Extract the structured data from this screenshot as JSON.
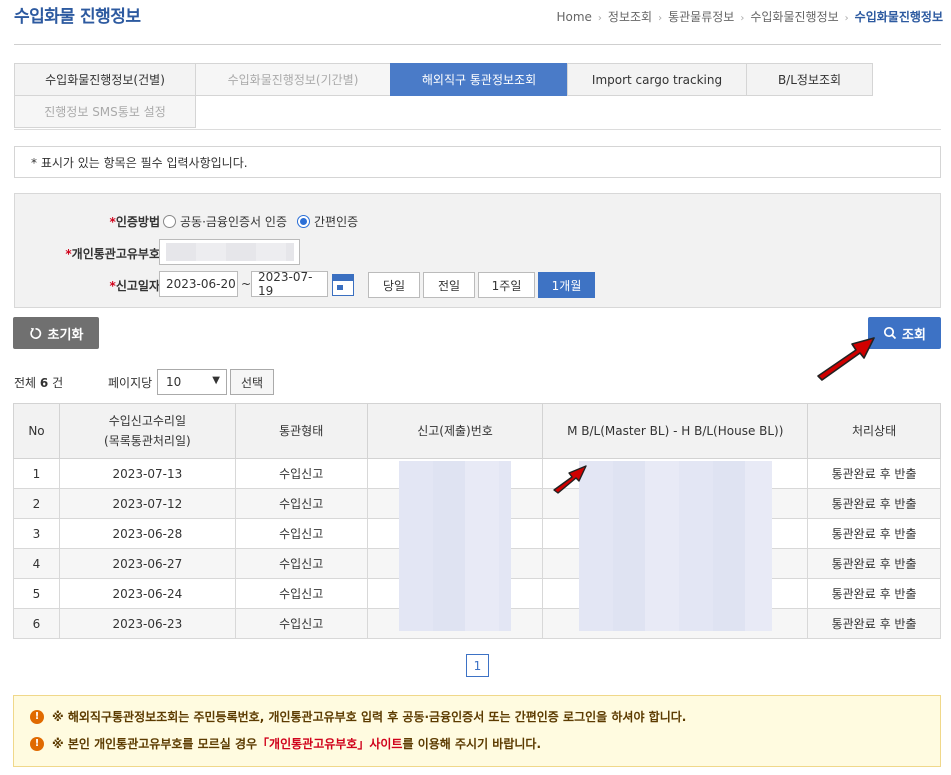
{
  "header": {
    "title": "수입화물 진행정보",
    "breadcrumb": [
      "Home",
      "정보조회",
      "통관물류정보",
      "수입화물진행정보",
      "수입화물진행정보"
    ]
  },
  "tabs": [
    [
      {
        "label": "수입화물진행정보(건별)",
        "state": "normal"
      },
      {
        "label": "수입화물진행정보(기간별)",
        "state": "disabled"
      },
      {
        "label": "해외직구 통관정보조회",
        "state": "active"
      },
      {
        "label": "Import cargo tracking",
        "state": "normal"
      },
      {
        "label": "B/L정보조회",
        "state": "normal"
      }
    ],
    [
      {
        "label": "진행정보 SMS통보 설정",
        "state": "disabled"
      }
    ]
  ],
  "notice": "* 표시가 있는 항목은 필수 입력사항입니다.",
  "form": {
    "auth_label": "인증방법",
    "auth_options": [
      {
        "label": "공동·금융인증서 인증",
        "checked": false
      },
      {
        "label": "간편인증",
        "checked": true
      }
    ],
    "pccc_label": "개인통관고유부호",
    "date_label": "신고일자",
    "date_from": "2023-06-20",
    "tilde": "~",
    "date_to": "2023-07-19",
    "period_buttons": [
      {
        "label": "당일",
        "active": false
      },
      {
        "label": "전일",
        "active": false
      },
      {
        "label": "1주일",
        "active": false
      },
      {
        "label": "1개월",
        "active": true
      }
    ]
  },
  "actions": {
    "reset": "초기화",
    "search": "조회"
  },
  "list": {
    "total_prefix": "전체",
    "total_count": "6",
    "total_suffix": "건",
    "per_page_label": "페이지당",
    "per_page_value": "10",
    "select_button": "선택"
  },
  "table": {
    "headers": [
      "No",
      "수입신고수리일",
      "(목록통관처리일)",
      "통관형태",
      "신고(제출)번호",
      "M B/L(Master BL) - H B/L(House BL))",
      "처리상태"
    ],
    "rows": [
      {
        "no": "1",
        "date": "2023-07-13",
        "type": "수입신고",
        "status": "통관완료 후 반출"
      },
      {
        "no": "2",
        "date": "2023-07-12",
        "type": "수입신고",
        "status": "통관완료 후 반출"
      },
      {
        "no": "3",
        "date": "2023-06-28",
        "type": "수입신고",
        "status": "통관완료 후 반출"
      },
      {
        "no": "4",
        "date": "2023-06-27",
        "type": "수입신고",
        "status": "통관완료 후 반출"
      },
      {
        "no": "5",
        "date": "2023-06-24",
        "type": "수입신고",
        "status": "통관완료 후 반출"
      },
      {
        "no": "6",
        "date": "2023-06-23",
        "type": "수입신고",
        "status": "통관완료 후 반출"
      }
    ]
  },
  "pagination": {
    "current": "1"
  },
  "warnings": {
    "line1": "※ 해외직구통관정보조회는 주민등록번호, 개인통관고유부호 입력 후 공동·금융인증서 또는 간편인증 로그인을 하셔야 합니다.",
    "line2_pre": "※ 본인 개인통관고유부호를 모르실 경우 ",
    "line2_link": "「개인통관고유부호」사이트",
    "line2_post": "를 이용해 주시기 바랍니다."
  },
  "colors": {
    "accent": "#3d72c5",
    "required": "#d0021b",
    "annotation": "#d00000"
  }
}
